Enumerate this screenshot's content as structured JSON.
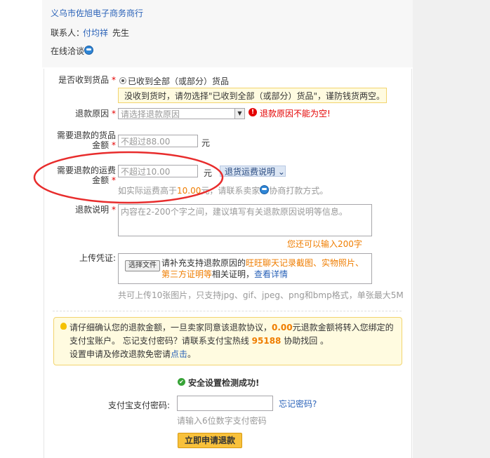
{
  "seller": {
    "company": "义乌市佐旭电子商务商行",
    "contact_label": "联系人：",
    "contact_name": "付均祥",
    "contact_title": "先生",
    "online_chat": "在线洽谈"
  },
  "form": {
    "received": {
      "label": "是否收到货品",
      "required_mark": "*",
      "option": "已收到全部（或部分）货品",
      "tip": "没收到货时，请勿选择\"已收到全部（或部分）货品\"，谨防钱货两空。"
    },
    "reason": {
      "label": "退款原因",
      "required_mark": "*",
      "placeholder": "请选择退款原因",
      "error": "退款原因不能为空!",
      "error_icon": "!"
    },
    "goods_amount": {
      "label": "需要退款的货品金额",
      "required_mark": "*",
      "placeholder": "不超过88.00",
      "unit": "元"
    },
    "shipping_amount": {
      "label": "需要退款的运费金额",
      "required_mark": "*",
      "placeholder": "不超过10.00",
      "unit": "元",
      "help_button": "退货运费说明",
      "hint_prefix": "如实际运费高于",
      "hint_amount": "10.00",
      "hint_suffix": "元，请联系卖家",
      "hint_end": "协商打款方式。"
    },
    "description": {
      "label": "退款说明",
      "required_mark": "*",
      "placeholder": "内容在2-200个字之间，建议填写有关退款原因说明等信息。",
      "counter": "您还可以输入200字"
    },
    "upload": {
      "label": "上传凭证:",
      "button": "选择文件",
      "text_prefix": "请补充支持退款原因的",
      "text_highlight": "旺旺聊天记录截图、实物照片、第三方证明等",
      "text_mid": "相关证明，",
      "text_link": "查看详情",
      "limits": "共可上传10张图片，只支持jpg、gif、jpeg、png和bmp格式，单张最大5M"
    }
  },
  "notice": {
    "line1_a": "请仔细确认您的退款金额，一旦卖家同意该退款协议，",
    "line1_amount": "0.00",
    "line1_b": "元退款金额将转入您绑定的支付宝账户。 忘记支付密码？请联系支付宝热线",
    "hotline": "95188",
    "line1_c": "协助找回 。",
    "line2_a": "设置申请及修改退款免密请",
    "line2_link": "点击",
    "line2_b": "。"
  },
  "security": {
    "status": "安全设置检测成功!",
    "pwd_label": "支付宝支付密码:",
    "forgot": "忘记密码?",
    "pwd_hint": "请输入6位数字支付密码",
    "submit": "立即申请退款"
  },
  "colors": {
    "link": "#2a62b8",
    "required": "#e40000",
    "highlight": "#ef7d00",
    "tip_bg": "#fffbe0",
    "annotation": "#e82c2c"
  }
}
